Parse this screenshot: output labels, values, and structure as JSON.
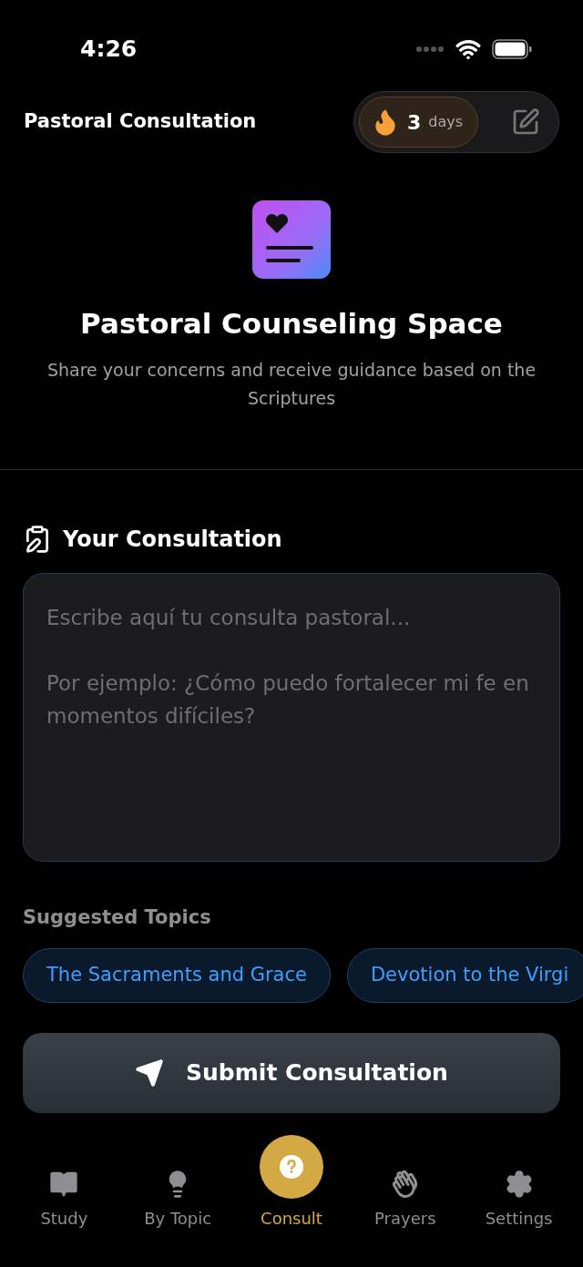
{
  "status_bar": {
    "time": "4:26"
  },
  "header": {
    "title": "Pastoral Consultation",
    "streak": {
      "count": "3",
      "unit": "days"
    }
  },
  "hero": {
    "title": "Pastoral Counseling Space",
    "subtitle": "Share your concerns and receive guidance based on the Scriptures"
  },
  "consultation": {
    "heading": "Your Consultation",
    "placeholder": "Escribe aquí tu consulta pastoral...\n\nPor ejemplo: ¿Cómo puedo fortalecer mi fe en momentos difíciles?"
  },
  "suggested": {
    "heading": "Suggested Topics",
    "topics": [
      "The Sacraments and Grace",
      "Devotion to the Virgi"
    ]
  },
  "submit_button": "Submit Consultation",
  "tab_bar": [
    {
      "kind": "book",
      "label": "Study",
      "selected": false
    },
    {
      "kind": "bulb",
      "label": "By Topic",
      "selected": false
    },
    {
      "kind": "question",
      "label": "Consult",
      "selected": true
    },
    {
      "kind": "hands",
      "label": "Prayers",
      "selected": false
    },
    {
      "kind": "gear",
      "label": "Settings",
      "selected": false
    }
  ]
}
